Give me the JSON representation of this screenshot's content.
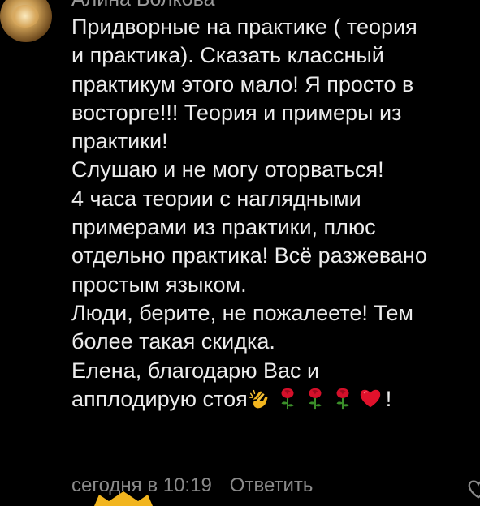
{
  "comment": {
    "author": "Алина Волкова",
    "lines": [
      "Придворные на практике ( теория",
      "и практика). Сказать классный",
      "практикум этого мало! Я просто в",
      "восторге!!! Теория и примеры из",
      "практики!",
      "Слушаю и не могу оторваться!",
      "4 часа теории с наглядными",
      "примерами из практики, плюс",
      "отдельно практика! Всё разжевано",
      "простым языком.",
      "Люди, берите, не пожалеете! Тем",
      "более такая скидка.",
      "Елена, благодарю Вас и"
    ],
    "last_line_text": "апплодирую стоя",
    "last_line_end": "!",
    "emojis": [
      "clapping-hands",
      "rose",
      "rose",
      "rose",
      "red-heart"
    ],
    "timestamp": "сегодня в 10:19",
    "reply_label": "Ответить"
  },
  "colors": {
    "background": "#000000",
    "text": "#ececec",
    "muted": "#8a8a8a",
    "rose": "#d4102a",
    "heart": "#e0112b",
    "clap": "#f2b51e"
  }
}
